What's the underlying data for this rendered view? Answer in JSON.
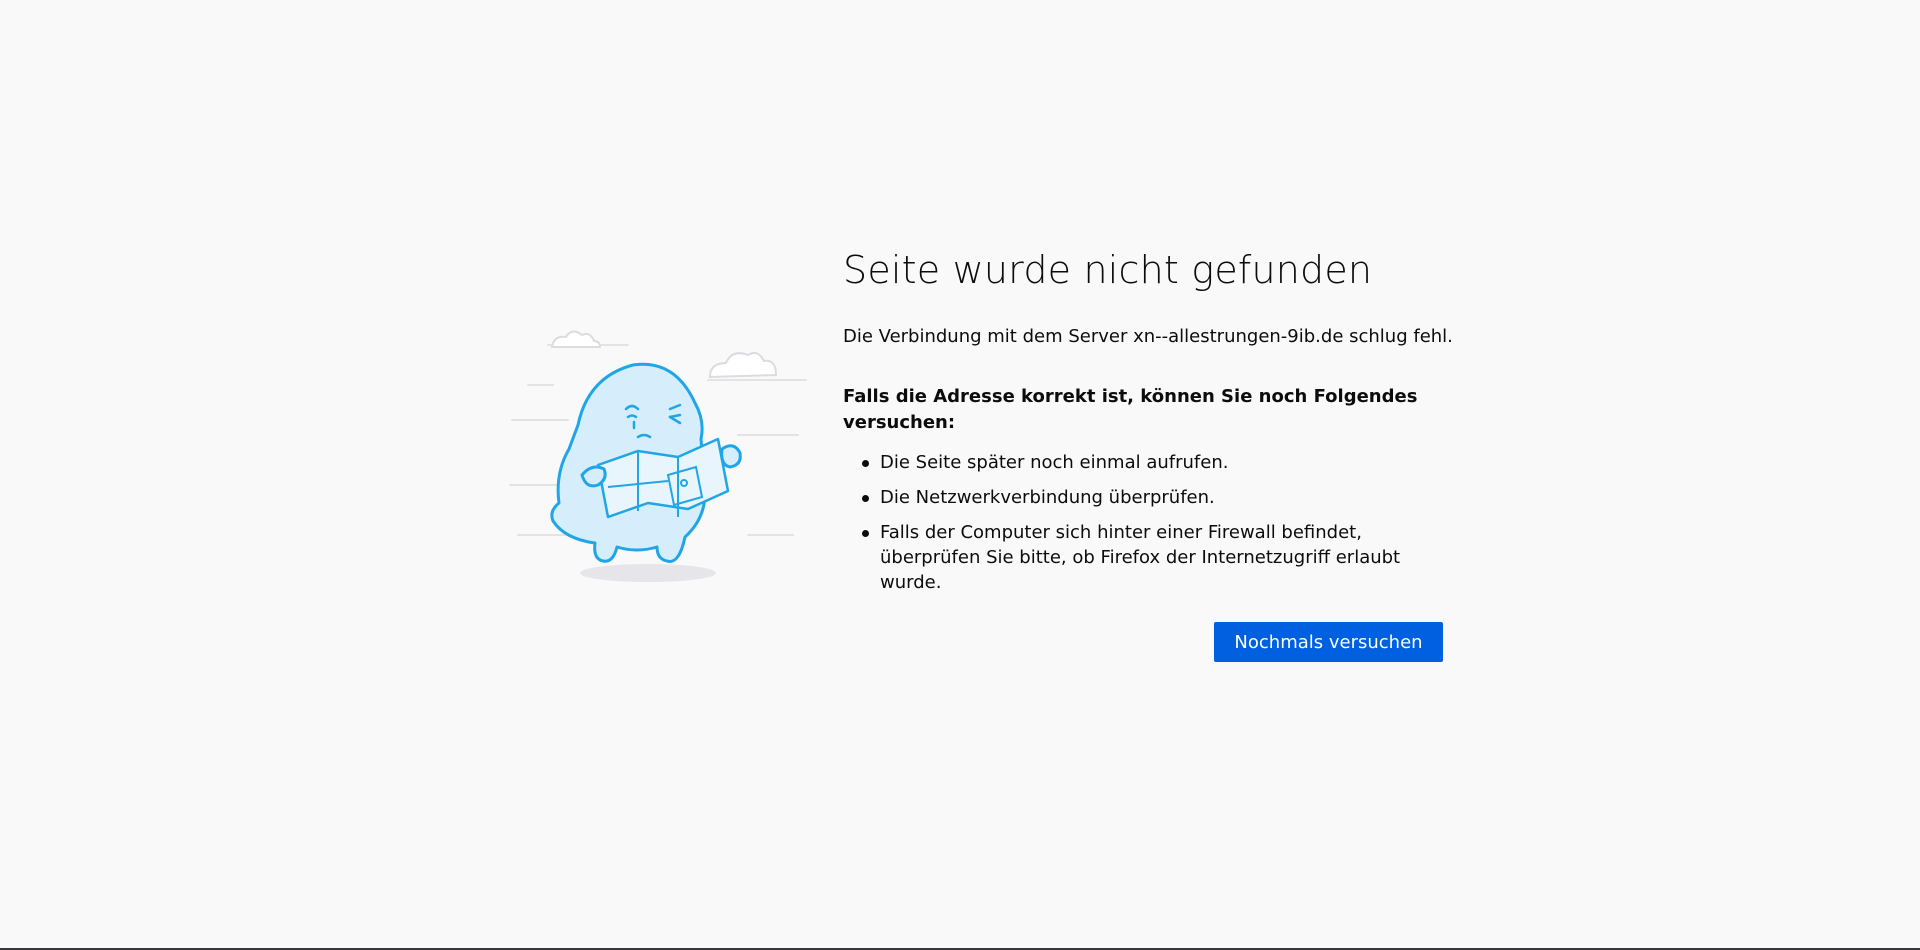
{
  "error": {
    "title": "Seite wurde nicht gefunden",
    "description": "Die Verbindung mit dem Server xn--allestrungen-9ib.de schlug fehl.",
    "try_heading": "Falls die Adresse korrekt ist, können Sie noch Folgendes versuchen:",
    "suggestions": [
      "Die Seite später noch einmal aufrufen.",
      "Die Netzwerkverbindung überprüfen.",
      "Falls der Computer sich hinter einer Firewall befindet, überprüfen Sie bitte, ob Firefox der Internetzugriff erlaubt wurde."
    ],
    "retry_label": "Nochmals versuchen"
  },
  "colors": {
    "background": "#f9f9fa",
    "accent": "#0060df",
    "illustration_stroke": "#20a5e6",
    "illustration_fill": "#d6eefb"
  },
  "icons": {
    "illustration": "lost-monster-with-map-illustration"
  }
}
